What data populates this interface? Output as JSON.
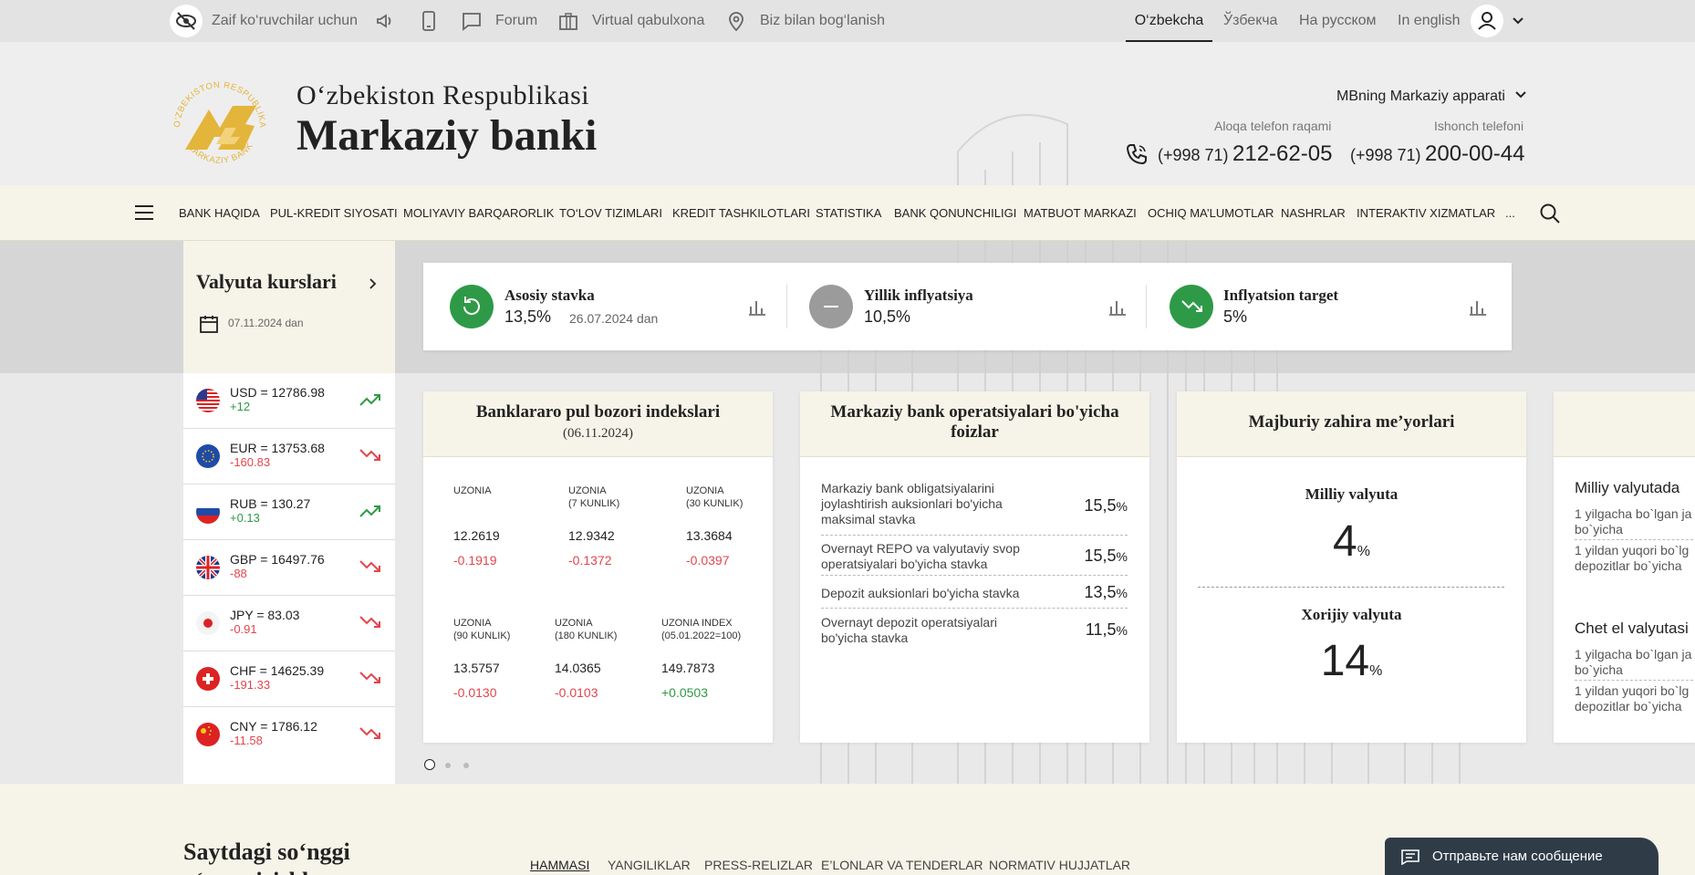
{
  "topbar": {
    "accessibility": "Zaif ko‘ruvchilar uchun",
    "forum": "Forum",
    "virtual": "Virtual qabulxona",
    "contact": "Biz bilan bog‘lanish",
    "languages": [
      "O‘zbekcha",
      "Ўзбекча",
      "На русском",
      "In english"
    ]
  },
  "header": {
    "title_line1": "O‘zbekiston Respublikasi",
    "title_line2": "Markaziy banki",
    "logo_ring_top": "O'ZBEKISTON RESPUBLIKASI",
    "logo_ring_bottom": "MARKAZIY BANKI",
    "apparatus": "MBning Markaziy apparati",
    "phone1_label": "Aloqa telefon raqami",
    "phone1_prefix": "(+998 71)",
    "phone1_number": "212-62-05",
    "phone2_label": "Ishonch telefoni",
    "phone2_prefix": "(+998 71)",
    "phone2_number": "200-00-44"
  },
  "nav": {
    "items": [
      "BANK HAQIDA",
      "PUL-KREDIT SIYOSATI",
      "MOLIYAVIY BARQARORLIK",
      "TO‘LOV TIZIMLARI",
      "KREDIT TASHKILOTLARI",
      "STATISTIKA",
      "BANK QONUNCHILIGI",
      "MATBUOT MARKAZI",
      "OCHIQ MA’LUMOTLAR",
      "NASHRLAR",
      "INTERAKTIV XIZMATLAR",
      "..."
    ]
  },
  "rates": {
    "title": "Valyuta kurslari",
    "date": "07.11.2024 dan",
    "items": [
      {
        "label": "USD = 12786.98",
        "delta": "+12",
        "dir": "up"
      },
      {
        "label": "EUR = 13753.68",
        "delta": "-160.83",
        "dir": "down"
      },
      {
        "label": "RUB = 130.27",
        "delta": "+0.13",
        "dir": "up"
      },
      {
        "label": "GBP = 16497.76",
        "delta": "-88",
        "dir": "down"
      },
      {
        "label": "JPY = 83.03",
        "delta": "-0.91",
        "dir": "down"
      },
      {
        "label": "CHF = 14625.39",
        "delta": "-191.33",
        "dir": "down"
      },
      {
        "label": "CNY = 1786.12",
        "delta": "-11.58",
        "dir": "down"
      }
    ]
  },
  "indicators": {
    "key_rate_label": "Asosiy stavka",
    "key_rate_value": "13,5%",
    "key_rate_date": "26.07.2024 dan",
    "inflation_label": "Yillik inflyatsiya",
    "inflation_value": "10,5%",
    "target_label": "Inflyatsion target",
    "target_value": "5%"
  },
  "uzonia": {
    "title": "Banklararo pul bozori indekslari",
    "date": "(06.11.2024)",
    "cells": [
      {
        "label1": "UZONIA",
        "label2": "",
        "value": "12.2619",
        "delta": "-0.1919",
        "dir": "down"
      },
      {
        "label1": "UZONIA",
        "label2": "(7 KUNLIK)",
        "value": "12.9342",
        "delta": "-0.1372",
        "dir": "down"
      },
      {
        "label1": "UZONIA",
        "label2": "(30 KUNLIK)",
        "value": "13.3684",
        "delta": "-0.0397",
        "dir": "down"
      },
      {
        "label1": "UZONIA",
        "label2": "(90 KUNLIK)",
        "value": "13.5757",
        "delta": "-0.0130",
        "dir": "down"
      },
      {
        "label1": "UZONIA",
        "label2": "(180 KUNLIK)",
        "value": "14.0365",
        "delta": "-0.0103",
        "dir": "down"
      },
      {
        "label1": "UZONIA INDEX",
        "label2": "(05.01.2022=100)",
        "value": "149.7873",
        "delta": "+0.0503",
        "dir": "up"
      }
    ]
  },
  "operations": {
    "title": "Markaziy bank operatsiyalari bo'yicha foizlar",
    "rows": [
      {
        "text": "Markaziy bank obligatsiyalarini joylashtirish auksionlari bo'yicha maksimal stavka",
        "value": "15,5",
        "unit": "%"
      },
      {
        "text": "Overnayt REPO va valyutaviy svop operatsiyalari bo'yicha stavka",
        "value": "15,5",
        "unit": "%"
      },
      {
        "text": "Depozit auksionlari bo'yicha stavka",
        "value": "13,5",
        "unit": "%"
      },
      {
        "text": "Overnayt depozit operatsiyalari bo'yicha stavka",
        "value": "11,5",
        "unit": "%"
      }
    ]
  },
  "reserve": {
    "title": "Majburiy zahira me’yorlari",
    "national_label": "Milliy valyuta",
    "national_value": "4",
    "foreign_label": "Xorijiy valyuta",
    "foreign_value": "14",
    "unit": "%"
  },
  "partial": {
    "section1": "Milliy valyutada",
    "s1_row1_a": "1 yilgacha bo`lgan ja",
    "s1_row1_b": "bo`yicha",
    "s1_row2_a": "1 yildan yuqori bo`lg",
    "s1_row2_b": "depozitlar bo`yicha",
    "section2": "Chet el valyutasi",
    "s2_row1_a": "1 yilgacha bo`lgan ja",
    "s2_row1_b": "bo`yicha",
    "s2_row2_a": "1 yildan yuqori bo`lg",
    "s2_row2_b": "depozitlar bo`yicha"
  },
  "news": {
    "title_line1": "Saytdagi so‘nggi",
    "title_line2": "o‘zgartirishlar",
    "tabs": [
      "HAMMASI",
      "YANGILIKLAR",
      "PRESS-RELIZLAR",
      "E’LONLAR VA TENDERLAR",
      "NORMATIV HUJJATLAR"
    ]
  },
  "chat": {
    "label": "Отправьте нам сообщение"
  },
  "colors": {
    "green": "#2e9a47",
    "red": "#e2454d",
    "gold": "#e4b53b",
    "cream": "#f6f4e8"
  }
}
